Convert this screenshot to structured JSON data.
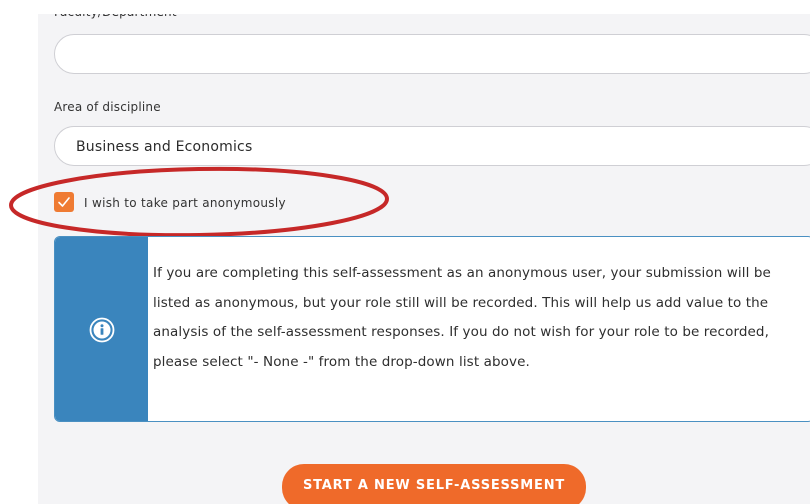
{
  "form": {
    "faculty_label": "Faculty/Department",
    "faculty_value": "",
    "area_label": "Area of discipline",
    "area_value": "Business and Economics",
    "anonymous_checked": true,
    "anonymous_label": "I wish to take part anonymously"
  },
  "info": {
    "icon": "info-icon",
    "text": "If you are completing this self-assessment as an anonymous user, your submission will be listed as anonymous, but your role still will be recorded. This will help us add value to the analysis of the self-assessment responses. If you do not wish for your role to be recorded, please select \"- None -\" from the drop-down list above."
  },
  "actions": {
    "start_label": "START A NEW SELF-ASSESSMENT"
  },
  "colors": {
    "accent": "#ef6a2a",
    "checkbox": "#ef7b33",
    "info_side": "#3a85bd",
    "annotation": "#c62828",
    "panel_bg": "#f4f4f6"
  }
}
